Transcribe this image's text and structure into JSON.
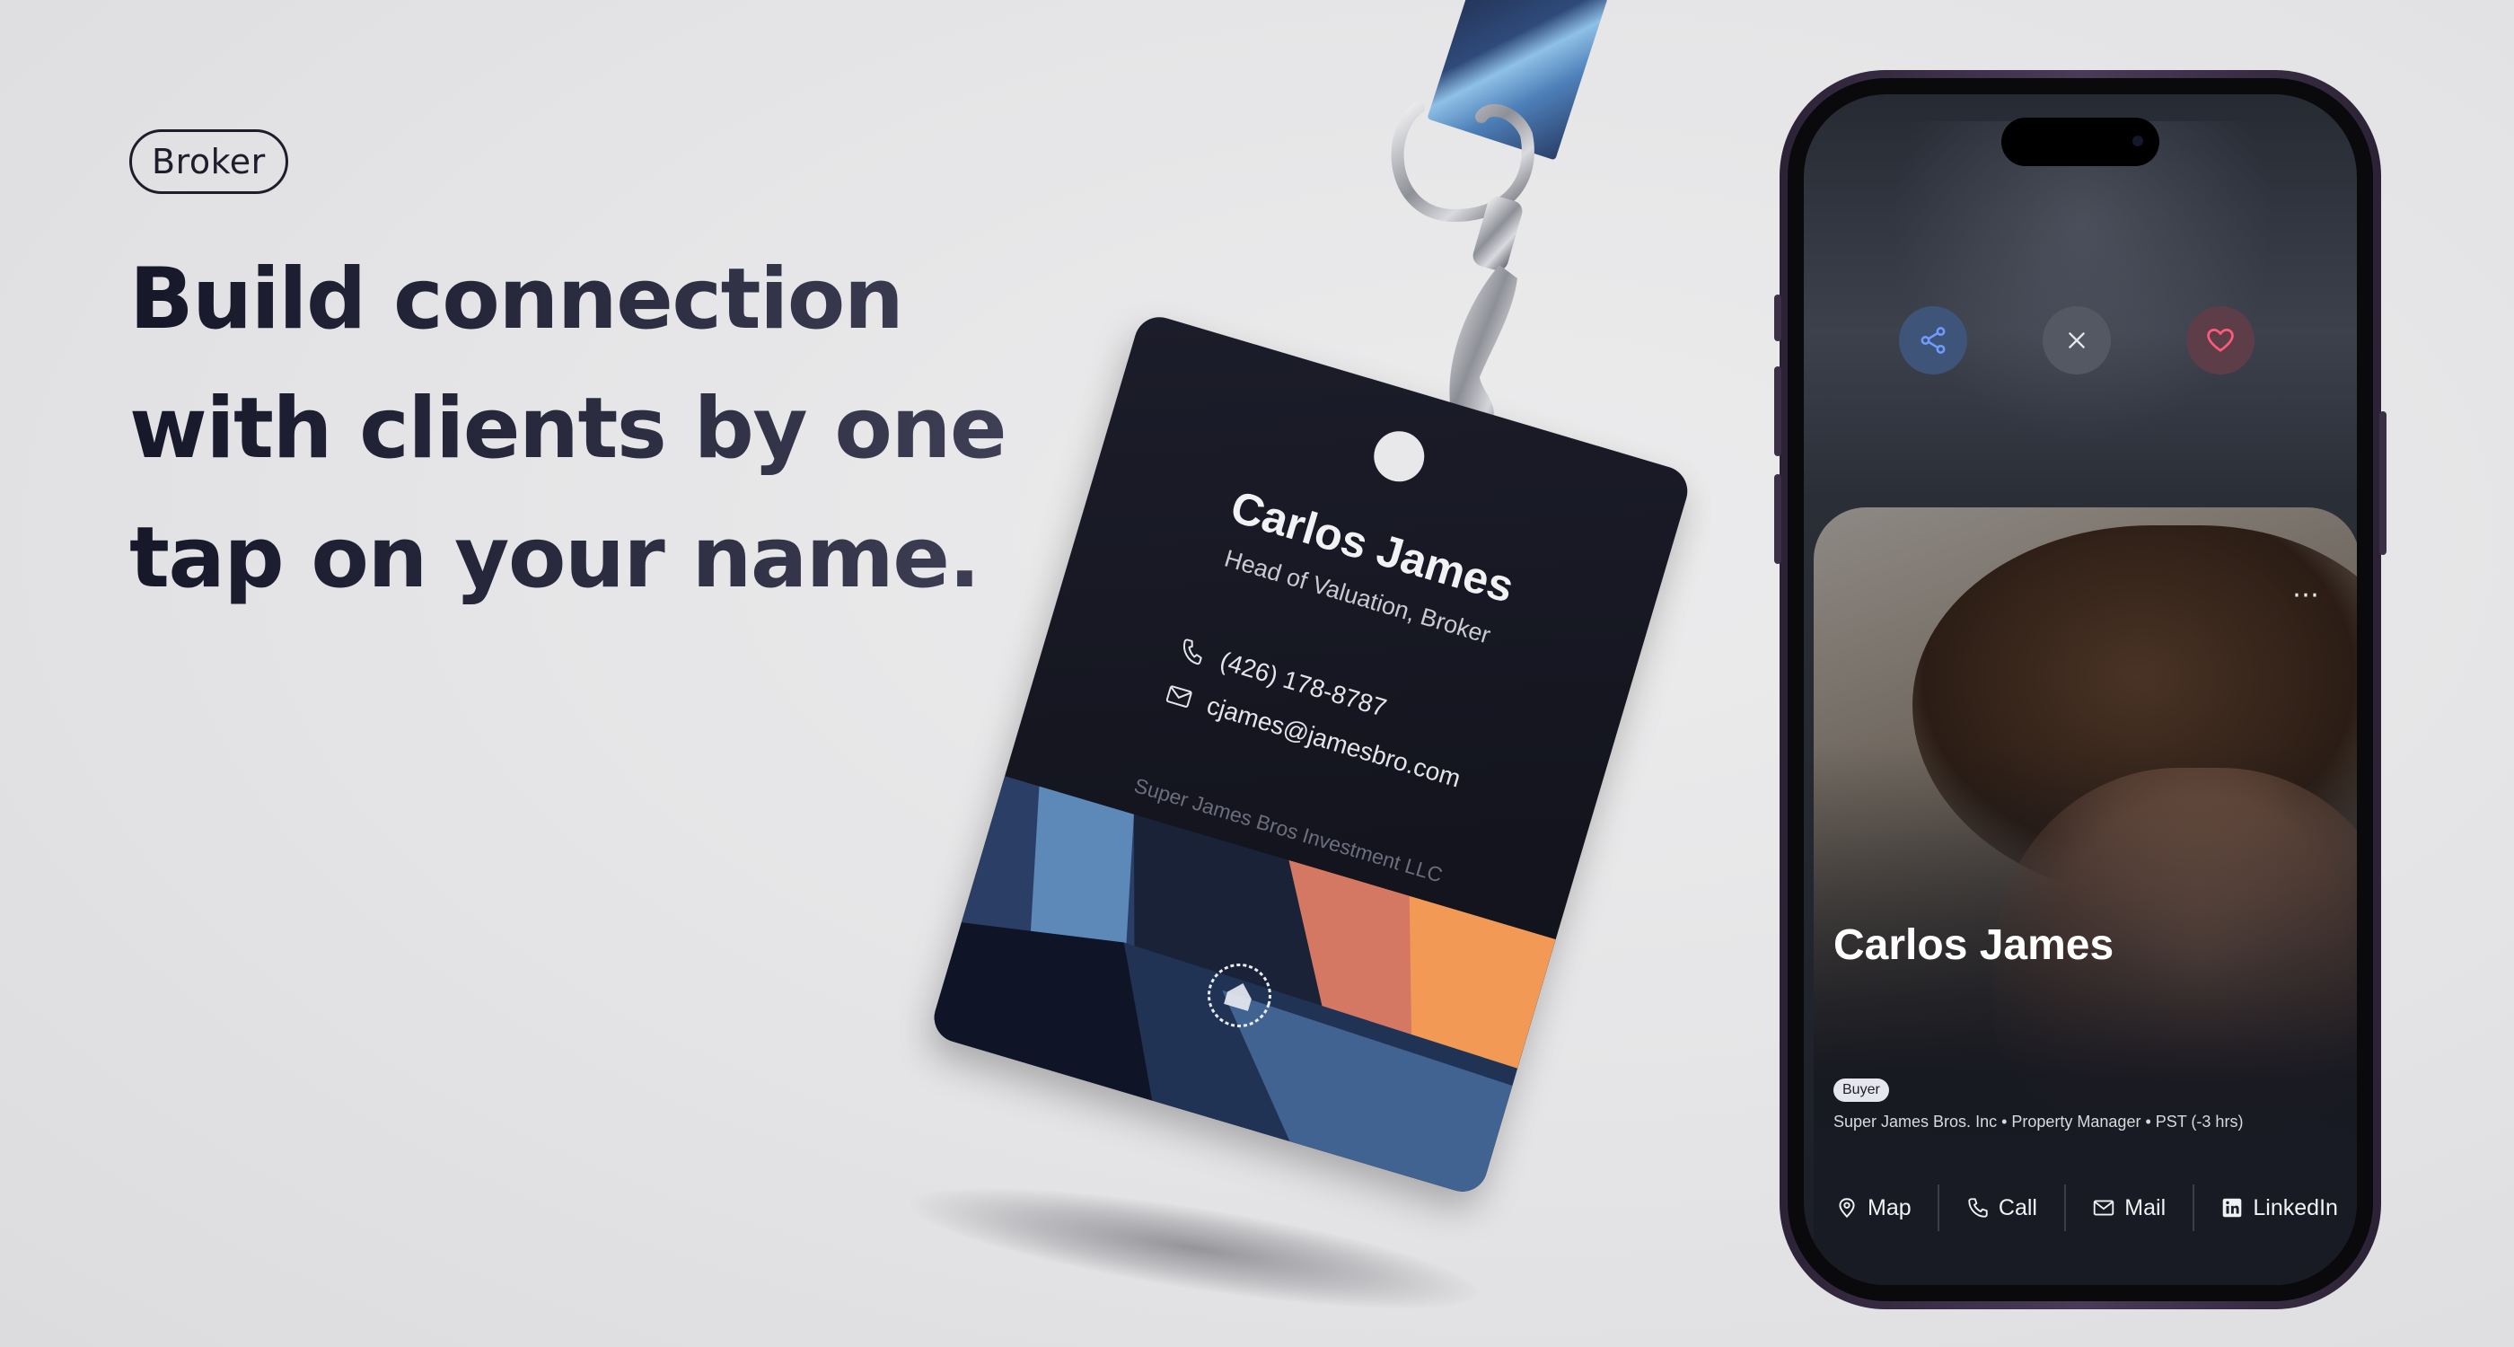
{
  "hero": {
    "tag": "Broker",
    "headline_lines": [
      "Build connection",
      "with clients by one",
      "tap on your name."
    ]
  },
  "badge": {
    "name": "Carlos James",
    "role": "Head of Valuation, Broker",
    "phone": "(426) 178-8787",
    "email": "cjames@jamesbro.com",
    "company": "Super James Bros Investment LLC",
    "icons": {
      "phone": "phone-icon",
      "email": "mail-icon",
      "logo": "company-seal-icon"
    }
  },
  "phone": {
    "actions": [
      {
        "name": "share",
        "icon": "share-icon",
        "color": "#6f9cff"
      },
      {
        "name": "close",
        "icon": "close-icon",
        "color": "#e6e7ec"
      },
      {
        "name": "favorite",
        "icon": "heart-icon",
        "color": "#ff5a7a"
      }
    ],
    "profile": {
      "more": "⋯",
      "name": "Carlos James",
      "tag": "Buyer",
      "meta": "Super James Bros. Inc • Property Manager • PST (-3 hrs)"
    },
    "links": [
      {
        "label": "Map",
        "icon": "map-pin-icon"
      },
      {
        "label": "Call",
        "icon": "phone-icon"
      },
      {
        "label": "Mail",
        "icon": "mail-icon"
      },
      {
        "label": "LinkedIn",
        "icon": "linkedin-icon"
      }
    ]
  },
  "colors": {
    "headline": "#1d1d2b",
    "badge_bg": "#16171f",
    "phone_frame": "#3b2f47",
    "accent_blue": "#4d7fb8",
    "accent_orange": "#f29a55"
  }
}
